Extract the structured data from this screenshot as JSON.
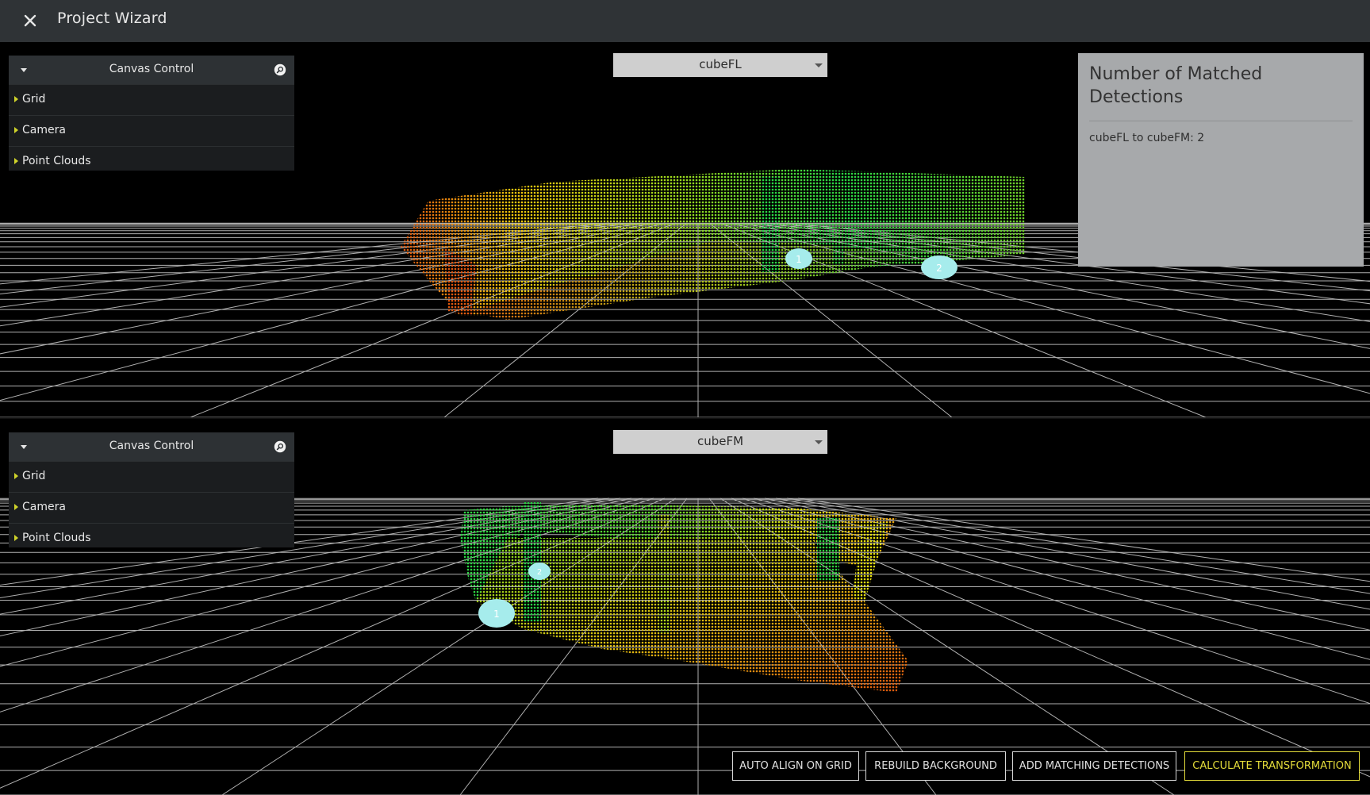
{
  "app": {
    "title": "Project Wizard",
    "close_icon": "close-icon"
  },
  "views": [
    {
      "canvas_control": {
        "title": "Canvas Control",
        "items": [
          "Grid",
          "Camera",
          "Point Clouds"
        ]
      },
      "sensor_select": {
        "value": "cubeFL"
      },
      "markers": [
        "1",
        "2"
      ]
    },
    {
      "canvas_control": {
        "title": "Canvas Control",
        "items": [
          "Grid",
          "Camera",
          "Point Clouds"
        ]
      },
      "sensor_select": {
        "value": "cubeFM"
      },
      "markers": [
        "1",
        "2"
      ]
    }
  ],
  "matched_panel": {
    "title": "Number of Matched Detections",
    "line": "cubeFL to cubeFM: 2"
  },
  "actions": {
    "auto_align": "AUTO ALIGN ON GRID",
    "rebuild_background": "REBUILD BACKGROUND",
    "add_matching": "ADD MATCHING DETECTIONS",
    "calculate": "CALCULATE TRANSFORMATION"
  },
  "colors": {
    "accent": "#e4dc3a",
    "titlebar": "#2f3336",
    "marker": "#a6ecec",
    "cloud_near": "#e0580f",
    "cloud_mid": "#f2d60c",
    "cloud_far": "#25d648"
  }
}
